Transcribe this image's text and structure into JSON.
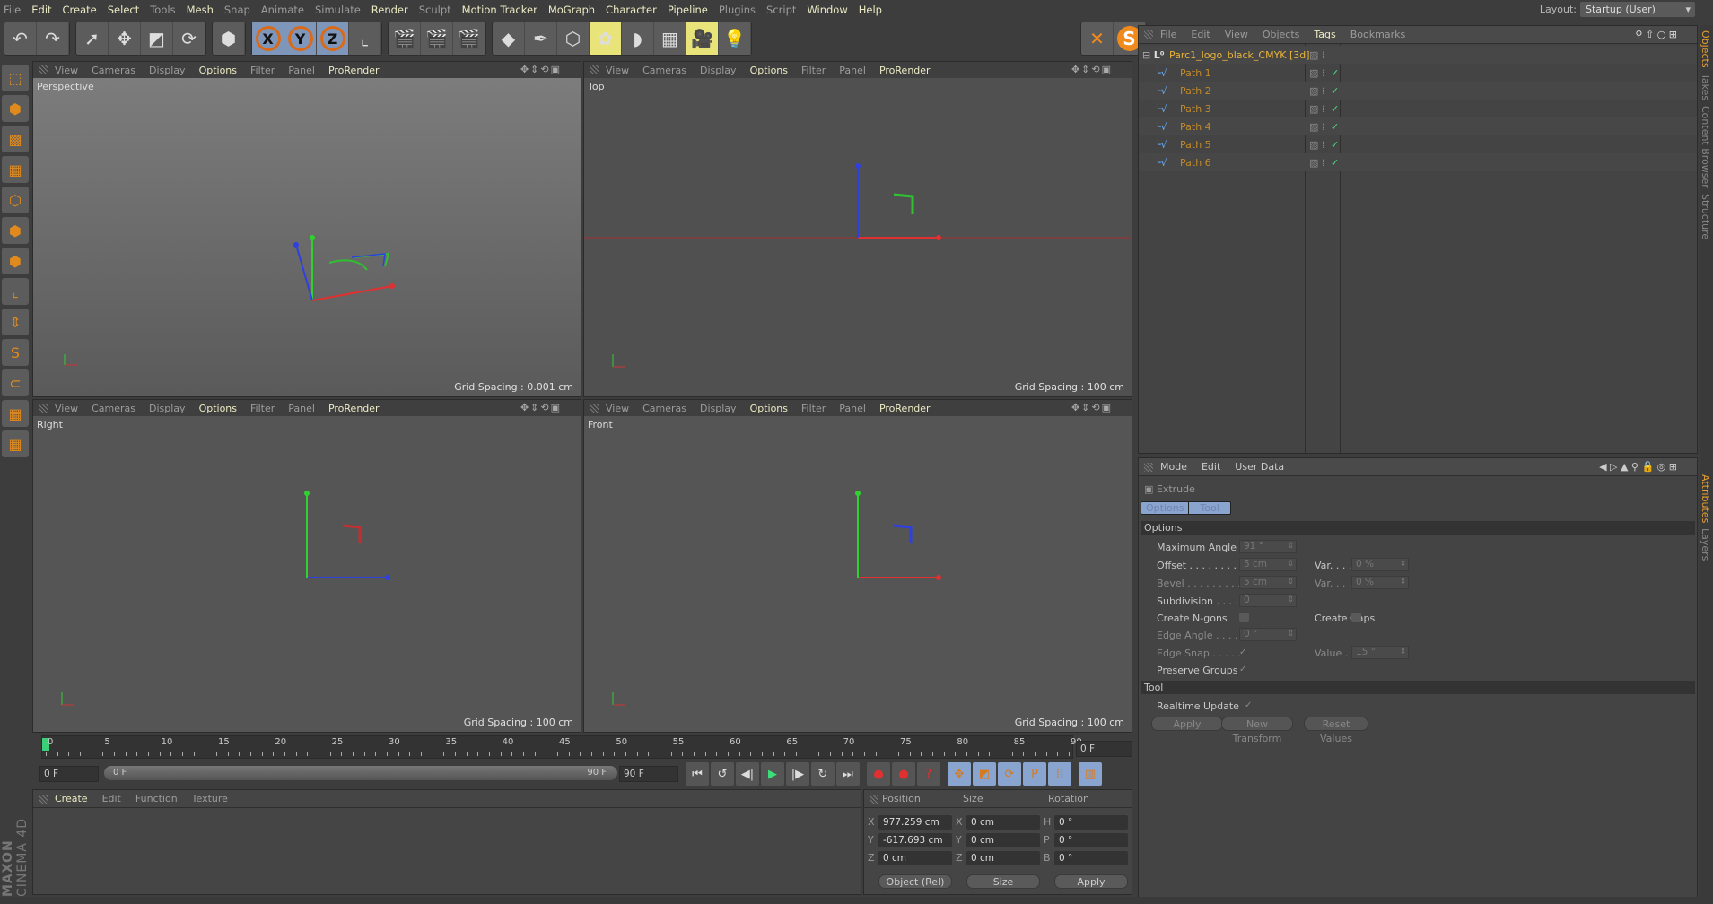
{
  "menu": [
    {
      "label": "File",
      "b": false
    },
    {
      "label": "Edit",
      "b": true
    },
    {
      "label": "Create",
      "b": true
    },
    {
      "label": "Select",
      "b": true
    },
    {
      "label": "Tools",
      "b": false
    },
    {
      "label": "Mesh",
      "b": true
    },
    {
      "label": "Snap",
      "b": false
    },
    {
      "label": "Animate",
      "b": false
    },
    {
      "label": "Simulate",
      "b": false
    },
    {
      "label": "Render",
      "b": true
    },
    {
      "label": "Sculpt",
      "b": false
    },
    {
      "label": "Motion Tracker",
      "b": true
    },
    {
      "label": "MoGraph",
      "b": true
    },
    {
      "label": "Character",
      "b": true
    },
    {
      "label": "Pipeline",
      "b": true
    },
    {
      "label": "Plugins",
      "b": false
    },
    {
      "label": "Script",
      "b": false
    },
    {
      "label": "Window",
      "b": true
    },
    {
      "label": "Help",
      "b": true
    }
  ],
  "layout": {
    "label": "Layout:",
    "value": "Startup (User)"
  },
  "toolbar_groups": [
    [
      {
        "icon": "undo-icon",
        "g": "↶"
      },
      {
        "icon": "redo-icon",
        "g": "↷"
      }
    ],
    [
      {
        "icon": "live-selection-icon",
        "g": "➚"
      },
      {
        "icon": "move-icon",
        "g": "✥"
      },
      {
        "icon": "scale-icon",
        "g": "◩"
      },
      {
        "icon": "rotate-icon",
        "g": "⟳"
      }
    ],
    [
      {
        "icon": "recent-tools-icon",
        "g": "⬢"
      }
    ],
    [
      {
        "icon": "x-axis-lock-icon",
        "g": "X",
        "c": "blue"
      },
      {
        "icon": "y-axis-lock-icon",
        "g": "Y",
        "c": "blue"
      },
      {
        "icon": "z-axis-lock-icon",
        "g": "Z",
        "c": "blue"
      },
      {
        "icon": "coordinate-system-icon",
        "g": "⌞"
      }
    ],
    [
      {
        "icon": "render-view-icon",
        "g": "🎬"
      },
      {
        "icon": "render-picture-viewer-icon",
        "g": "🎬"
      },
      {
        "icon": "render-settings-icon",
        "g": "🎬"
      }
    ],
    [
      {
        "icon": "cube-icon",
        "g": "◆"
      },
      {
        "icon": "pen-icon",
        "g": "✒"
      },
      {
        "icon": "subdivision-icon",
        "g": "⬡"
      },
      {
        "icon": "mograph-cloner-icon",
        "g": "✿",
        "c": "yel"
      },
      {
        "icon": "deformer-icon",
        "g": "◗"
      },
      {
        "icon": "floor-icon",
        "g": "▦"
      },
      {
        "icon": "camera-icon",
        "g": "🎥",
        "c": "yel"
      },
      {
        "icon": "light-icon",
        "g": "💡"
      }
    ],
    [
      {
        "icon": "xpresso-icon",
        "g": "✕"
      },
      {
        "icon": "s-plugin-icon",
        "g": "S"
      }
    ]
  ],
  "left_tools": [
    "make-editable-icon",
    "model-mode-icon",
    "texture-mode-icon",
    "workplane-icon",
    "points-mode-icon",
    "edges-mode-icon",
    "polygons-mode-icon",
    "axis-mode-icon",
    "tweak-mode-icon",
    "solo-icon",
    "snap-icon",
    "lock-workplane-icon",
    "planar-workplane-icon"
  ],
  "viewport_menu": [
    "View",
    "Cameras",
    "Display",
    "Options",
    "Filter",
    "Panel",
    "ProRender"
  ],
  "viewports": [
    {
      "name": "Perspective",
      "grid": "Grid Spacing : 0.001 cm"
    },
    {
      "name": "Top",
      "grid": "Grid Spacing : 100 cm"
    },
    {
      "name": "Right",
      "grid": "Grid Spacing : 100 cm"
    },
    {
      "name": "Front",
      "grid": "Grid Spacing : 100 cm"
    }
  ],
  "objects": {
    "menu": [
      "File",
      "Edit",
      "View",
      "Objects",
      "Tags",
      "Bookmarks"
    ],
    "root": "Parc1_logo_black_CMYK [3d]",
    "items": [
      "Path 1",
      "Path 2",
      "Path 3",
      "Path 4",
      "Path 5",
      "Path 6"
    ]
  },
  "side_tabs_top": [
    "Objects",
    "Takes",
    "Content Browser",
    "Structure"
  ],
  "side_tabs_bottom": [
    "Attributes",
    "Layers"
  ],
  "attributes": {
    "menu": [
      "Mode",
      "Edit",
      "User Data"
    ],
    "tool": "Extrude",
    "tabs": [
      "Options",
      "Tool"
    ],
    "section_options": "Options",
    "section_tool": "Tool",
    "max_angle": {
      "label": "Maximum Angle",
      "value": "91 °"
    },
    "offset": {
      "label": "Offset . . . . . . . . .",
      "value": "5 cm"
    },
    "offset_var": {
      "label": "Var. . . . . . . . .",
      "value": "0 %"
    },
    "bevel": {
      "label": "Bevel . . . . . . . . .",
      "value": "5 cm"
    },
    "bevel_var": {
      "label": "Var. . . . . . . . .",
      "value": "0 %"
    },
    "subdivision": {
      "label": "Subdivision . . . .",
      "value": "0"
    },
    "ngons": {
      "label": "Create N-gons",
      "checked": false
    },
    "caps": {
      "label": "Create Caps",
      "checked": false
    },
    "edge_angle": {
      "label": "Edge Angle . . . .",
      "value": "0 °"
    },
    "edge_snap": {
      "label": "Edge Snap . . . . .",
      "checked": true
    },
    "snap_value": {
      "label": "Value . . . . .",
      "value": "15 °"
    },
    "preserve": {
      "label": "Preserve Groups",
      "checked": true
    },
    "realtime": {
      "label": "Realtime Update",
      "checked": true
    },
    "buttons": [
      "Apply",
      "New Transform",
      "Reset Values"
    ]
  },
  "timeline": {
    "labels": [
      "0",
      "5",
      "10",
      "15",
      "20",
      "25",
      "30",
      "35",
      "40",
      "45",
      "50",
      "55",
      "60",
      "65",
      "70",
      "75",
      "80",
      "85",
      "90"
    ],
    "current": "0 F",
    "start": "0 F",
    "range_start": "0 F",
    "range_end": "90 F",
    "end": "90 F"
  },
  "transport": [
    "go-to-start-icon",
    "previous-key-icon",
    "previous-frame-icon",
    "play-icon",
    "next-frame-icon",
    "next-key-icon",
    "go-to-end-icon",
    "record-icon",
    "autokey-icon",
    "keyframe-selection-icon",
    "key-position-icon",
    "key-scale-icon",
    "key-rotation-icon",
    "key-parameter-icon",
    "key-pla-icon",
    "timeline-icon"
  ],
  "materials": {
    "menu": [
      "Create",
      "Edit",
      "Function",
      "Texture"
    ]
  },
  "logo": "MAXON CINEMA 4D",
  "coords": {
    "headers": [
      "Position",
      "Size",
      "Rotation"
    ],
    "pos": [
      {
        "axis": "X",
        "value": "977.259 cm"
      },
      {
        "axis": "Y",
        "value": "-617.693 cm"
      },
      {
        "axis": "Z",
        "value": "0 cm"
      }
    ],
    "size": [
      {
        "axis": "X",
        "value": "0 cm"
      },
      {
        "axis": "Y",
        "value": "0 cm"
      },
      {
        "axis": "Z",
        "value": "0 cm"
      }
    ],
    "rot": [
      {
        "axis": "H",
        "value": "0 °"
      },
      {
        "axis": "P",
        "value": "0 °"
      },
      {
        "axis": "B",
        "value": "0 °"
      }
    ],
    "mode": "Object (Rel)",
    "size_mode": "Size",
    "apply": "Apply"
  }
}
